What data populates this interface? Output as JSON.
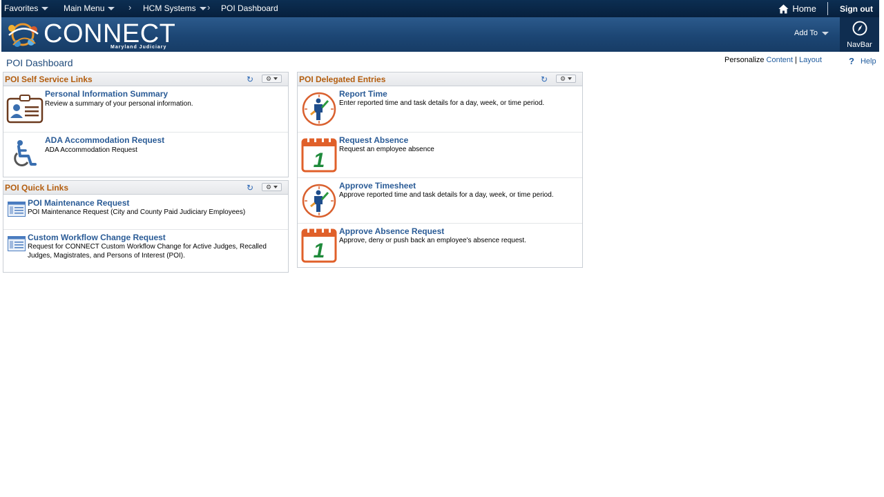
{
  "topbar": {
    "favorites": "Favorites",
    "main_menu": "Main Menu",
    "breadcrumbs": [
      "HCM Systems",
      "POI Dashboard"
    ],
    "home": "Home",
    "signout": "Sign out"
  },
  "banner": {
    "logo_text": "CONNECT",
    "logo_subtext": "Maryland Judiciary",
    "add_to": "Add To",
    "navbar": "NavBar"
  },
  "page": {
    "title": "POI Dashboard",
    "personalize_label": "Personalize",
    "personalize_content": "Content",
    "personalize_sep": "|",
    "personalize_layout": "Layout",
    "help": "Help"
  },
  "pagelets": {
    "self_service": {
      "title": "POI Self Service Links",
      "items": [
        {
          "link": "Personal Information Summary",
          "desc": "Review a summary of your personal information."
        },
        {
          "link": "ADA Accommodation Request",
          "desc": "ADA Accommodation Request"
        }
      ]
    },
    "quick_links": {
      "title": "POI Quick Links",
      "items": [
        {
          "link": "POI Maintenance Request",
          "desc": "POI Maintenance Request (City and County Paid Judiciary Employees)"
        },
        {
          "link": "Custom Workflow Change Request",
          "desc": "Request for CONNECT Custom Workflow Change for Active Judges, Recalled Judges, Magistrates, and Persons of Interest (POI)."
        }
      ]
    },
    "delegated": {
      "title": "POI Delegated Entries",
      "items": [
        {
          "link": "Report Time",
          "desc": "Enter reported time and task details for a day, week, or time period."
        },
        {
          "link": "Request Absence",
          "desc": "Request an employee absence"
        },
        {
          "link": "Approve Timesheet",
          "desc": "Approve reported time and task details for a day, week, or time period."
        },
        {
          "link": "Approve Absence Request",
          "desc": "Approve, deny or push back an employee's absence request."
        }
      ]
    }
  },
  "icons": {
    "id_card": "id-card-icon",
    "wheelchair": "wheelchair-icon",
    "form": "form-icon",
    "clock": "clock-person-icon",
    "calendar": "calendar-icon",
    "calendar_number": "1"
  },
  "colors": {
    "topbar": "#0c2e52",
    "banner": "#1c4674",
    "pagelet_title": "#b35d0e",
    "link": "#2a5b96",
    "calendar_orange": "#e0602a",
    "calendar_green": "#1f8a3b"
  }
}
